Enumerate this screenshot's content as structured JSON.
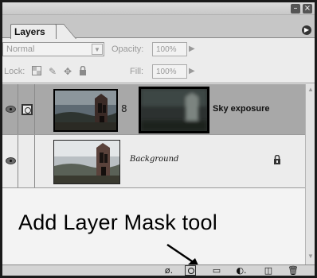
{
  "panel": {
    "tab_label": "Layers",
    "window_buttons": [
      "minimize-icon",
      "close-icon"
    ],
    "menu_icon": "panel-menu-icon"
  },
  "blend": {
    "mode_value": "Normal",
    "opacity_label": "Opacity:",
    "opacity_value": "100%"
  },
  "lock": {
    "label": "Lock:",
    "icons": [
      "lock-transparent-icon",
      "lock-image-icon",
      "lock-position-icon",
      "lock-all-icon"
    ],
    "fill_label": "Fill:",
    "fill_value": "100%"
  },
  "layers": [
    {
      "name": "Sky exposure",
      "visible": true,
      "has_mask": true,
      "selected": true
    },
    {
      "name": "Background",
      "visible": true,
      "has_mask": false,
      "locked": true,
      "selected": false
    }
  ],
  "annotation": {
    "text": "Add Layer Mask tool"
  },
  "toolbar": {
    "buttons": [
      "layer-style-icon",
      "add-layer-mask-icon",
      "new-group-icon",
      "adjustment-layer-icon",
      "new-layer-icon",
      "delete-layer-icon"
    ]
  },
  "colors": {
    "selected_row": "#a8a8a8",
    "panel_bg": "#ececec",
    "border": "#1a1a1a"
  }
}
